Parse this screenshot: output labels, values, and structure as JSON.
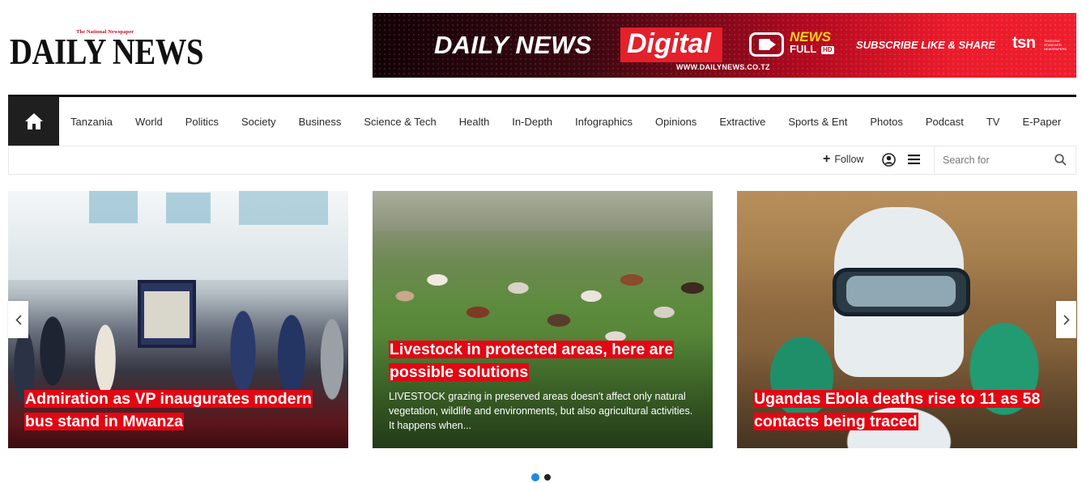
{
  "header": {
    "logo_tagline": "The National Newspaper",
    "logo_name": "DAILY NEWS",
    "banner": {
      "brand": "DAILY NEWS",
      "digital": "Digital",
      "url": "WWW.DAILYNEWS.CO.TZ",
      "news": "NEWS",
      "full": "FULL",
      "hd": "HD",
      "subscribe": "SUBSCRIBE LIKE & SHARE",
      "partner": "tsn",
      "partner_sub": "TANZANIA STANDARD NEWSPAPERS"
    }
  },
  "nav": {
    "home_icon": "home-icon",
    "items": [
      "Tanzania",
      "World",
      "Politics",
      "Society",
      "Business",
      "Science & Tech",
      "Health",
      "In-Depth",
      "Infographics",
      "Opinions",
      "Extractive",
      "Sports & Ent",
      "Photos",
      "Podcast",
      "TV",
      "E-Paper"
    ]
  },
  "toolbar": {
    "follow_label": "Follow",
    "search_placeholder": "Search for"
  },
  "slider": {
    "cards": [
      {
        "title": "Admiration as VP inaugurates modern bus stand in Mwanza",
        "excerpt": ""
      },
      {
        "title": "Livestock in protected areas, here are possible solutions",
        "excerpt": "LIVESTOCK grazing in preserved areas doesn't affect only natural vegetation, wildlife and environments, but also agricultural activities. It happens when..."
      },
      {
        "title": "Ugandas Ebola deaths rise to 11 as 58 contacts being traced",
        "excerpt": ""
      }
    ],
    "active_dot": 0,
    "dot_count": 2
  },
  "colors": {
    "accent_red": "#e30613",
    "nav_dark": "#1f1f1f",
    "dot_active": "#1e88e5"
  }
}
